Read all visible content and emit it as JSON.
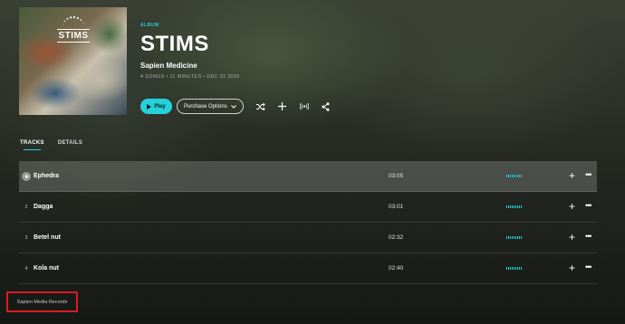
{
  "album": {
    "type_label": "ALBUM",
    "title": "STIMS",
    "artist": "Sapien Medicine",
    "details": "4 SONGS • 11 MINUTES • DEC 02 2025",
    "art_text": "STIMS"
  },
  "actions": {
    "play_label": "Play",
    "purchase_label": "Purchase Options",
    "icons": [
      "shuffle-icon",
      "add-icon",
      "cast-icon",
      "share-icon"
    ]
  },
  "tabs": [
    {
      "label": "TRACKS",
      "active": true
    },
    {
      "label": "DETAILS",
      "active": false
    }
  ],
  "tracks": [
    {
      "num": "1",
      "title": "Ephedra",
      "duration": "03:05",
      "playing": true
    },
    {
      "num": "2",
      "title": "Dagga",
      "duration": "03:01"
    },
    {
      "num": "3",
      "title": "Betel nut",
      "duration": "02:32"
    },
    {
      "num": "4",
      "title": "Kola nut",
      "duration": "02:40"
    }
  ],
  "record_label": "Sapien Media Records",
  "colors": {
    "accent": "#25d1da",
    "highlight_box": "#d91c24"
  }
}
